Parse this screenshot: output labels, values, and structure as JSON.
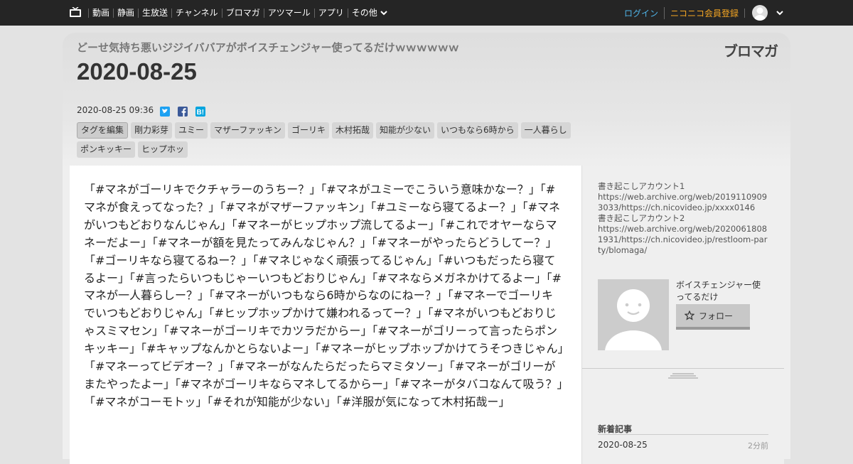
{
  "nav": {
    "items": [
      "動画",
      "静画",
      "生放送",
      "チャンネル",
      "ブロマガ",
      "アツマール",
      "アプリ"
    ],
    "more": "その他",
    "login": "ログイン",
    "register": "ニコニコ会員登録"
  },
  "blog": {
    "name": "どーせ気持ち悪いジジイババアがボイスチェンジャー使ってるだけｗｗｗｗｗｗ",
    "logo": "ブロマガ"
  },
  "article": {
    "title": "2020-08-25",
    "datetime": "2020-08-25 09:36",
    "tag_edit": "タグを編集",
    "tags": [
      "剛力彩芽",
      "ユミー",
      "マザーファッキン",
      "ゴーリキ",
      "木村拓哉",
      "知能が少ない",
      "いつもなら6時から",
      "一人暮らし",
      "ポンキッキー",
      "ヒップホッ"
    ],
    "body": "「#マネがゴーリキでクチャラーのうちー？」「#マネがユミーでこういう意味かなー？」「#マネが食えってなった？」「#マネがマザーファッキン」「#ユミーなら寝てるよー？」「#マネがいつもどおりなんじゃん」「#マネーがヒップホップ流してるよー」「#これでオヤーならマネーだよー」「#マネーが額を見たってみんなじゃん？」「#マネーがやったらどうしてー？」「#ゴーリキなら寝てるねー？」「#マネじゃなく頑張ってるじゃん」「#いつもだったら寝てるよー」「#言ったらいつもじゃーいつもどおりじゃん」「#マネならメガネかけてるよー」「#マネが一人暮らしー？」「#マネーがいつもなら6時からなのにねー？」「#マネーでゴーリキでいつもどおりじゃん」「#ヒップホップかけて嫌われるってー？」「#マネがいつもどおりじゃスミマセン」「#マネーがゴーリキでカツラだからー」「#マネーがゴリーって言ったらポンキッキー」「#キャップなんかとらないよー」「#マネーがヒップホップかけてうそつきじゃん」「#マネーってビデオー？」「#マネーがなんたらだったらマミタソー」「#マネーがゴリーがまたやったよー」「#マネがゴーリキならマネしてるからー」「#マネーがタバコなんて吸う？」「#マネがコーモトッ」「#それが知能が少ない」「#洋服が気になって木村拓哉ー」"
  },
  "sidebar": {
    "links_text": "書き起こしアカウント1\nhttps://web.archive.org/web/20191109093033/https://ch.nicovideo.jp/xxxx0146\n書き起こしアカウント2\nhttps://web.archive.org/web/20200618081931/https://ch.nicovideo.jp/restloom-party/blomaga/",
    "profile_name": "ボイスチェンジャー使ってるだけ",
    "follow_label": "フォロー",
    "new_articles_title": "新着記事",
    "new_article_date": "2020-08-25",
    "new_article_ago": "2分前"
  },
  "colors": {
    "topbar": "#252525",
    "login": "#4fb4e8",
    "register": "#f5a623",
    "twitter": "#1da1f2",
    "facebook": "#3b5998",
    "hatena": "#00a4de"
  },
  "icons": {
    "site": "tv-icon",
    "more": "chevron-down-icon",
    "avatar": "user-avatar-icon",
    "share": [
      "twitter-icon",
      "facebook-icon",
      "hatena-bookmark-icon"
    ],
    "follow": "star-icon"
  }
}
